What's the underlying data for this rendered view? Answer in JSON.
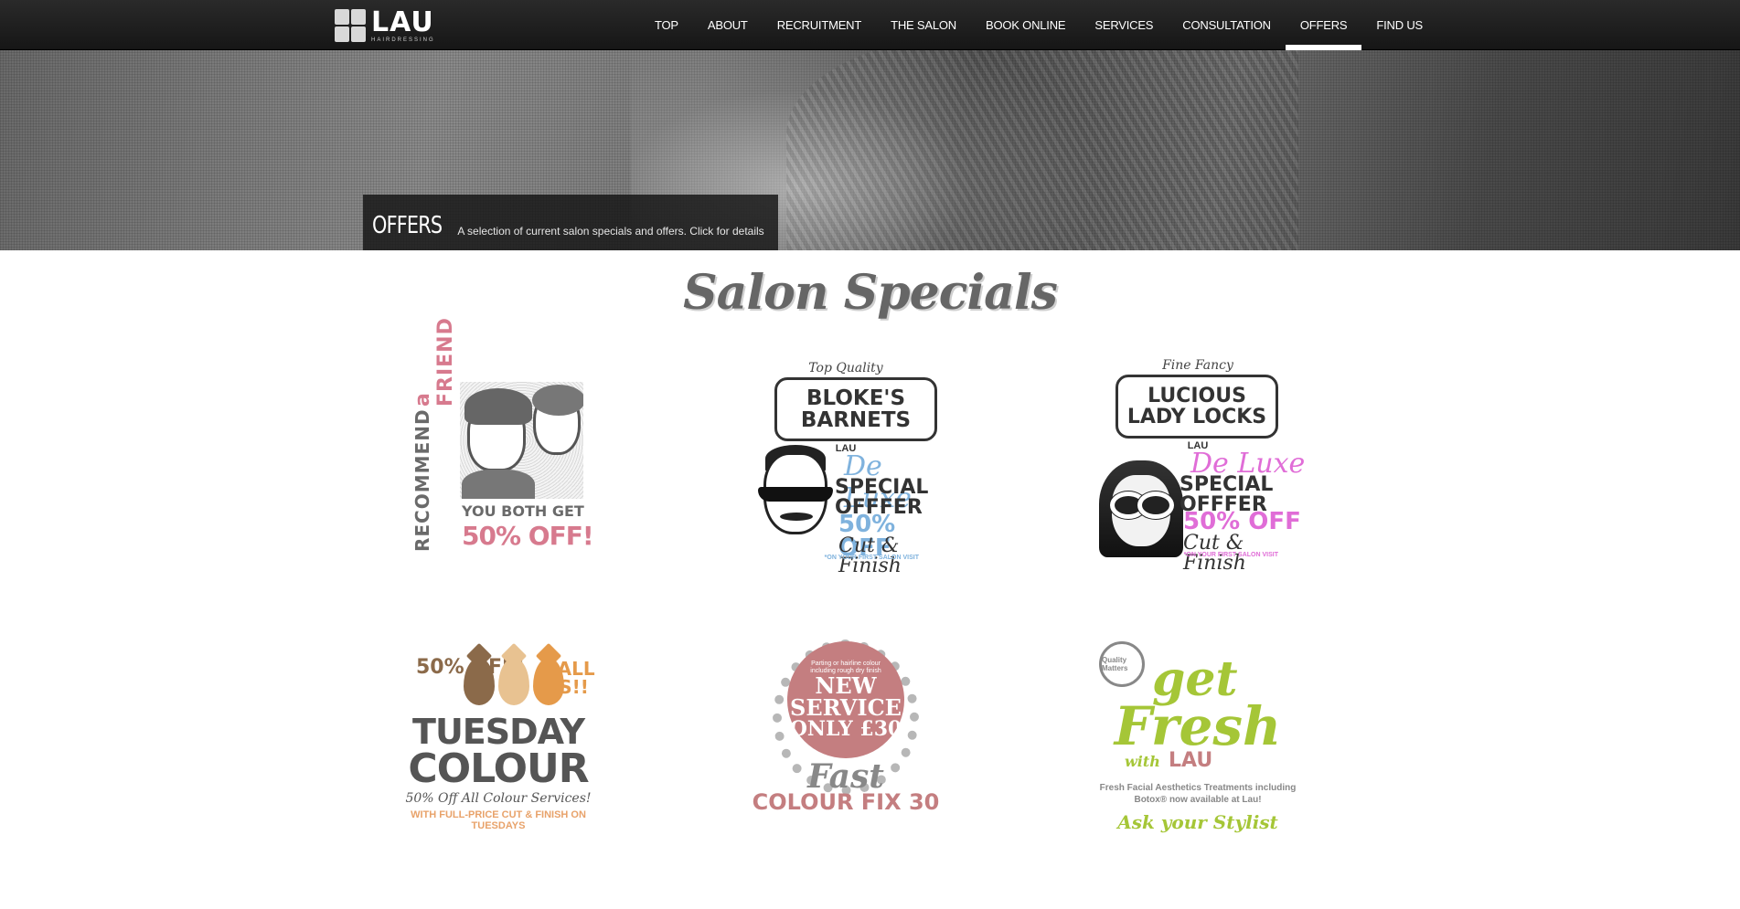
{
  "header": {
    "logo": {
      "word": "LAU",
      "subtitle": "HAIRDRESSING"
    },
    "nav": [
      {
        "label": "TOP"
      },
      {
        "label": "ABOUT"
      },
      {
        "label": "RECRUITMENT"
      },
      {
        "label": "THE SALON"
      },
      {
        "label": "BOOK ONLINE"
      },
      {
        "label": "SERVICES"
      },
      {
        "label": "CONSULTATION"
      },
      {
        "label": "OFFERS",
        "active": true
      },
      {
        "label": "FIND US"
      }
    ]
  },
  "hero": {
    "title": "OFFERS",
    "description": "A selection of current salon specials and offers. Click for details"
  },
  "main": {
    "section_title": "Salon Specials",
    "offers": [
      {
        "vertical_left": "RECOMMEND",
        "vertical_right": "a FRIEND",
        "line1": "YOU BOTH GET",
        "line2": "50% OFF!"
      },
      {
        "top": "Top Quality",
        "banner1": "BLOKE'S",
        "banner2": "BARNETS",
        "brand": "LAU",
        "deluxe": "De Luxe",
        "special1": "SPECIAL",
        "special2": "OFFFER",
        "pct": "50% OFF",
        "cut": "Cut & Finish",
        "fine": "*ON YOUR FIRST SALON VISIT"
      },
      {
        "top": "Fine Fancy",
        "banner1": "LUCIOUS",
        "banner2": "LADY LOCKS",
        "brand": "LAU",
        "deluxe": "De Luxe",
        "special1": "SPECIAL",
        "special2": "OFFFER",
        "pct": "50% OFF",
        "cut": "Cut & Finish",
        "fine": "*ON YOUR FIRST SALON VISIT"
      },
      {
        "left": "50% OFF!",
        "right": "CALL US!!",
        "title1": "TUESDAY",
        "title2": "COLOUR",
        "sub1": "50% Off All Colour Services!",
        "sub2": "WITH FULL-PRICE CUT & FINISH ON TUESDAYS"
      },
      {
        "small": "Parting or hairline colour including rough dry finish",
        "new1": "NEW",
        "new2": "SERVICE",
        "price": "ONLY £30",
        "title1": "Fast",
        "title2": "COLOUR FIX 30"
      },
      {
        "seal": "Quality Matters",
        "get": "get",
        "fresh": "Fresh",
        "with": "with",
        "brand": "LAU",
        "desc": "Fresh Facial Aesthetics Treatments including Botox® now available at Lau!",
        "ask": "Ask your Stylist"
      }
    ]
  },
  "colors": {
    "nav_bg": "#1e1e1e",
    "pink": "#d77a8e",
    "blue": "#7fb2dd",
    "magenta": "#e06dd7",
    "green": "#a5c637",
    "rose": "#c47e80"
  }
}
